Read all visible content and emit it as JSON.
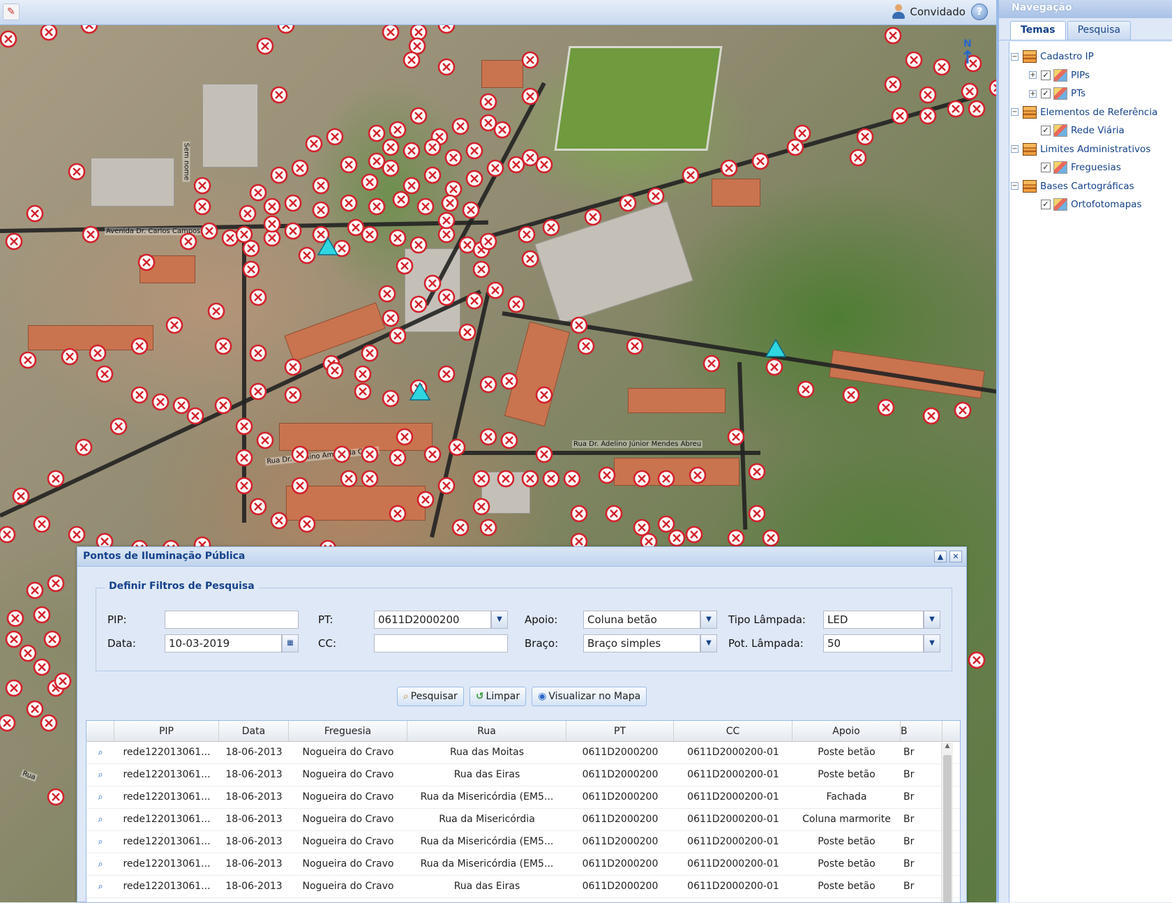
{
  "topbar": {
    "user_label": "Convidado",
    "user_icon": "user-icon",
    "help_icon": "help-icon"
  },
  "map": {
    "north_label": "N",
    "street_labels": [
      "Avenida Dr. Carlos Campos",
      "Rua Dr. Adelino Júnior Mendes Abreu",
      "Rua Dr. Adelino Amaro da Costa",
      "Sem nome",
      "Rua"
    ],
    "marker_icon": "red-cross-circle-icon",
    "pt_icon": "cyan-triangle-icon"
  },
  "navigation": {
    "title": "Navegação",
    "tabs": [
      {
        "label": "Temas",
        "active": true
      },
      {
        "label": "Pesquisa",
        "active": false
      }
    ],
    "tree": [
      {
        "label": "Cadastro IP",
        "level": 0,
        "type": "group"
      },
      {
        "label": "PIPs",
        "level": 1,
        "type": "layer",
        "checked": true
      },
      {
        "label": "PTs",
        "level": 1,
        "type": "layer",
        "checked": true
      },
      {
        "label": "Elementos de Referência",
        "level": 0,
        "type": "group"
      },
      {
        "label": "Rede Viária",
        "level": 1,
        "type": "layer",
        "checked": true
      },
      {
        "label": "Limites Administrativos",
        "level": 0,
        "type": "group"
      },
      {
        "label": "Freguesias",
        "level": 1,
        "type": "layer",
        "checked": true
      },
      {
        "label": "Bases Cartográficas",
        "level": 0,
        "type": "group"
      },
      {
        "label": "Ortofotomapas",
        "level": 1,
        "type": "layer",
        "checked": true
      }
    ]
  },
  "dialog": {
    "title": "Pontos de Iluminação Pública",
    "filter_legend": "Definir Filtros de Pesquisa",
    "fields": {
      "pip": {
        "label": "PIP:",
        "value": ""
      },
      "data": {
        "label": "Data:",
        "value": "10-03-2019"
      },
      "pt": {
        "label": "PT:",
        "value": "0611D2000200"
      },
      "cc": {
        "label": "CC:",
        "value": ""
      },
      "apoio": {
        "label": "Apoio:",
        "value": "Coluna betão"
      },
      "braco": {
        "label": "Braço:",
        "value": "Braço simples"
      },
      "tipo_lampada": {
        "label": "Tipo Lâmpada:",
        "value": "LED"
      },
      "pot_lampada": {
        "label": "Pot. Lâmpada:",
        "value": "50"
      }
    },
    "buttons": {
      "search": "Pesquisar",
      "clear": "Limpar",
      "show_map": "Visualizar no Mapa"
    },
    "grid": {
      "columns": [
        "",
        "PIP",
        "Data",
        "Freguesia",
        "Rua",
        "PT",
        "CC",
        "Apoio",
        "B"
      ],
      "rows": [
        [
          "rede122013061...",
          "18-06-2013",
          "Nogueira do Cravo",
          "Rua das Moitas",
          "0611D2000200",
          "0611D2000200-01",
          "Poste betão",
          "Br"
        ],
        [
          "rede122013061...",
          "18-06-2013",
          "Nogueira do Cravo",
          "Rua das Eiras",
          "0611D2000200",
          "0611D2000200-01",
          "Poste betão",
          "Br"
        ],
        [
          "rede122013061...",
          "18-06-2013",
          "Nogueira do Cravo",
          "Rua da Misericórdia (EM5...",
          "0611D2000200",
          "0611D2000200-01",
          "Fachada",
          "Br"
        ],
        [
          "rede122013061...",
          "18-06-2013",
          "Nogueira do Cravo",
          "Rua da Misericórdia",
          "0611D2000200",
          "0611D2000200-01",
          "Coluna marmorite",
          "Br"
        ],
        [
          "rede122013061...",
          "18-06-2013",
          "Nogueira do Cravo",
          "Rua da Misericórdia (EM5...",
          "0611D2000200",
          "0611D2000200-01",
          "Poste betão",
          "Br"
        ],
        [
          "rede122013061...",
          "18-06-2013",
          "Nogueira do Cravo",
          "Rua da Misericórdia (EM5...",
          "0611D2000200",
          "0611D2000200-01",
          "Poste betão",
          "Br"
        ],
        [
          "rede122013061...",
          "18-06-2013",
          "Nogueira do Cravo",
          "Rua das Eiras",
          "0611D2000200",
          "0611D2000200-01",
          "Poste betão",
          "Br"
        ]
      ]
    }
  }
}
